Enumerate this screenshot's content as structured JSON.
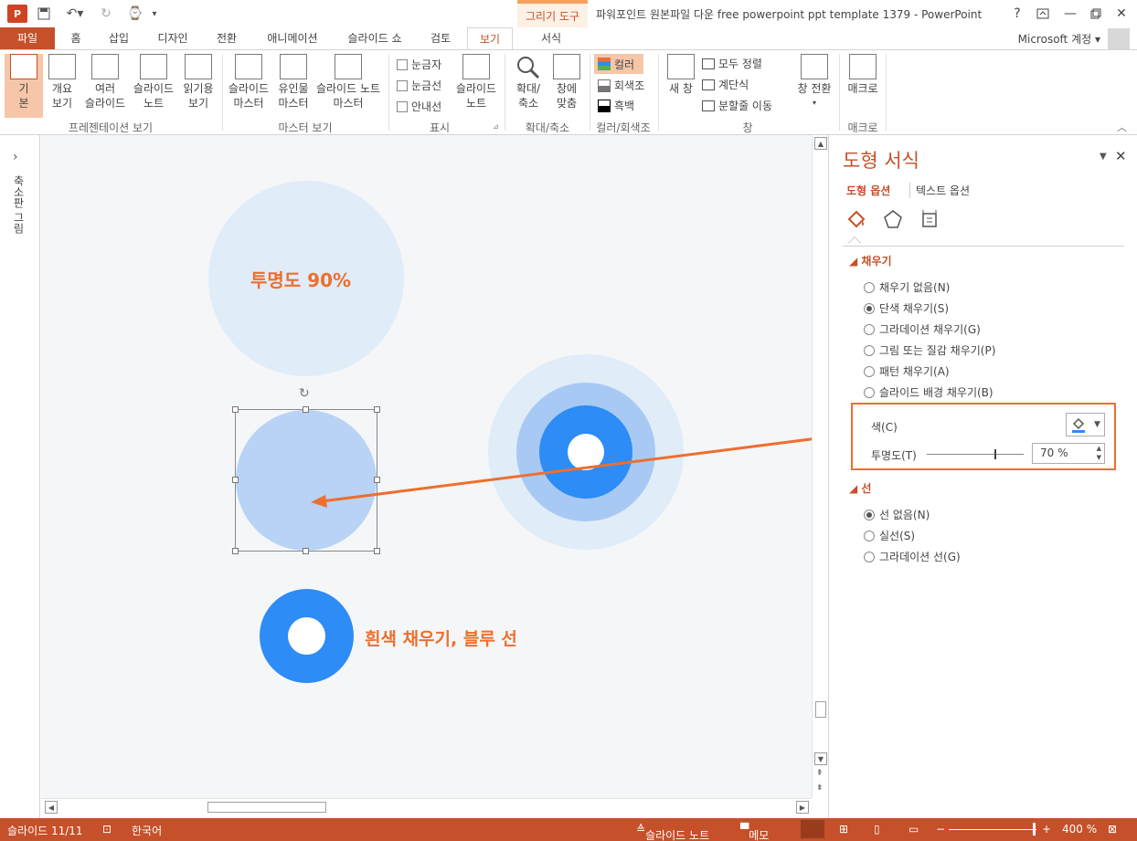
{
  "window": {
    "title": "파워포인트 원본파일 다운 free powerpoint ppt template 1379 - PowerPoint",
    "context_tab": "그리기 도구",
    "help": "?",
    "account": "Microsoft 계정"
  },
  "tabs": [
    "파일",
    "홈",
    "삽입",
    "디자인",
    "전환",
    "애니메이션",
    "슬라이드 쇼",
    "검토",
    "보기",
    "서식"
  ],
  "ribbon": {
    "presentation_views": {
      "label": "프레젠테이션 보기",
      "normal": "기\n본",
      "outline": "개요\n보기",
      "slide_sorter": "여러\n슬라이드",
      "notes_page": "슬라이드\n노트",
      "reading": "읽기용\n보기"
    },
    "master_views": {
      "label": "마스터 보기",
      "slide_master": "슬라이드\n마스터",
      "handout_master": "유인물\n마스터",
      "notes_master": "슬라이드 노트\n마스터"
    },
    "show": {
      "label": "표시",
      "ruler": "눈금자",
      "gridlines": "눈금선",
      "guides": "안내선",
      "notes": "슬라이드\n노트"
    },
    "zoom": {
      "label": "확대/축소",
      "zoom": "확대/\n축소",
      "fit": "창에\n맞춤"
    },
    "color": {
      "label": "컬러/회색조",
      "color": "컬러",
      "grayscale": "회색조",
      "bw": "흑백"
    },
    "window": {
      "label": "창",
      "new_window": "새 창",
      "arrange_all": "모두 정렬",
      "cascade": "계단식",
      "move_split": "분할줄 이동",
      "switch": "창 전환"
    },
    "macros": {
      "label": "매크로",
      "macros": "매크로"
    }
  },
  "left_strip": {
    "label": "축소판 그림"
  },
  "slide": {
    "text_transparency": "투명도 90%",
    "text_white_fill": "흰색 채우기, 블루 선",
    "colors": {
      "light_circle": "#e1ecf9",
      "selected_circle": "#b8d3f5",
      "blue": "#2d8cf5",
      "ring_mid": "#a8c9f3",
      "accent": "#ed6f2e"
    }
  },
  "pane": {
    "title": "도형 서식",
    "tab_shape": "도형 옵션",
    "tab_text": "텍스트 옵션",
    "icons": [
      "fill-line-icon",
      "effects-icon",
      "size-properties-icon"
    ],
    "fill_section": "채우기",
    "fill_options": [
      "채우기 없음(N)",
      "단색 채우기(S)",
      "그라데이션 채우기(G)",
      "그림 또는 질감 채우기(P)",
      "패턴 채우기(A)",
      "슬라이드 배경 채우기(B)"
    ],
    "fill_selected_index": 1,
    "color_label": "색(C)",
    "transparency_label": "투명도(T)",
    "transparency_value": "70 %",
    "transparency_level": 0.7,
    "line_section": "선",
    "line_options": [
      "선 없음(N)",
      "실선(S)",
      "그라데이션 선(G)"
    ],
    "line_selected_index": 0
  },
  "status": {
    "slide": "슬라이드 11/11",
    "language": "한국어",
    "notes": "슬라이드 노트",
    "comments": "메모",
    "zoom": "400 %"
  }
}
